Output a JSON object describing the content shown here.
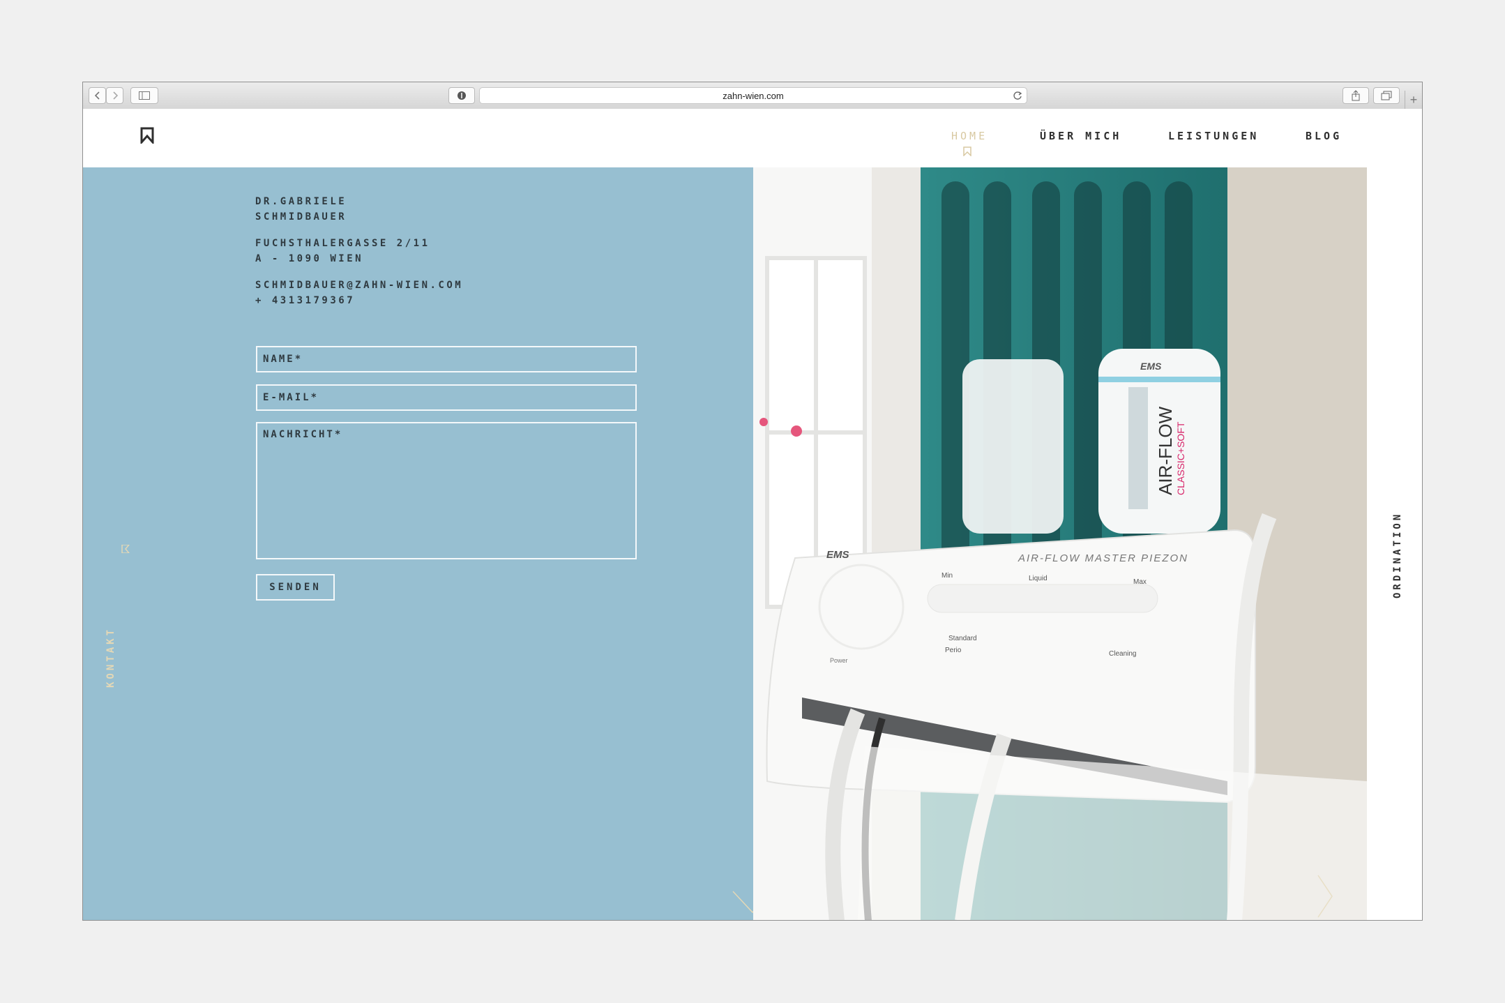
{
  "browser": {
    "url": "zahn-wien.com",
    "new_tab_symbol": "+"
  },
  "nav": {
    "items": [
      {
        "label": "HOME",
        "active": true
      },
      {
        "label": "ÜBER MICH",
        "active": false
      },
      {
        "label": "LEISTUNGEN",
        "active": false
      },
      {
        "label": "BLOG",
        "active": false
      }
    ]
  },
  "contact": {
    "name_line1": "DR.GABRIELE",
    "name_line2": "SCHMIDBAUER",
    "address_line1": "FUCHSTHALERGASSE 2/11",
    "address_line2": "A - 1090 WIEN",
    "email": "SCHMIDBAUER@ZAHN-WIEN.COM",
    "phone": "+ 4313179367"
  },
  "form": {
    "name_placeholder": "NAME*",
    "email_placeholder": "E-MAIL*",
    "message_placeholder": "NACHRICHT*",
    "submit_label": "SENDEN"
  },
  "side_labels": {
    "left": "KONTAKT",
    "right": "ORDINATION"
  },
  "photo": {
    "device_brand": "EMS",
    "device_model": "AIR-FLOW MASTER PIEZON",
    "canister_label": "AIR-FLOW",
    "canister_sublabel": "CLASSIC+SOFT",
    "panel_min": "Min",
    "panel_liquid": "Liquid",
    "panel_max": "Max",
    "panel_standard": "Standard",
    "panel_perio": "Perio",
    "panel_cleaning": "Cleaning",
    "panel_power": "Power"
  },
  "colors": {
    "panel_blue": "#97bfd1",
    "accent_gold": "#d8c9a2",
    "text_dark": "#2f3a40"
  }
}
